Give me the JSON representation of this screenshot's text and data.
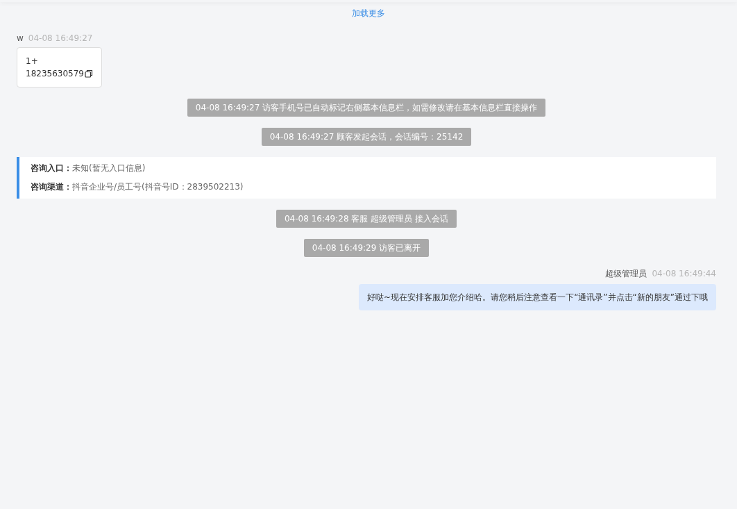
{
  "load_more": "加载更多",
  "messages": [
    {
      "kind": "visitor",
      "sender": "w",
      "time": "04-08 16:49:27",
      "text": "1+\n18235630579"
    },
    {
      "kind": "system",
      "text": "04-08 16:49:27 访客手机号已自动标记右侧基本信息栏，如需修改请在基本信息栏直接操作"
    },
    {
      "kind": "system",
      "text": "04-08 16:49:27 顾客发起会话，会话编号：25142"
    },
    {
      "kind": "info",
      "fields": [
        {
          "label": "咨询入口：",
          "value": "未知(暂无入口信息)"
        },
        {
          "label": "咨询渠道：",
          "value": "抖音企业号/员工号(抖音号ID：2839502213)"
        }
      ]
    },
    {
      "kind": "system",
      "text": "04-08 16:49:28 客服 超级管理员 接入会话"
    },
    {
      "kind": "system",
      "text": "04-08 16:49:29 访客已离开"
    },
    {
      "kind": "agent",
      "sender": "超级管理员",
      "time": "04-08 16:49:44",
      "text": "好哒~现在安排客服加您介绍哈。请您稍后注意查看一下“通讯录”并点击“新的朋友”通过下哦"
    }
  ]
}
